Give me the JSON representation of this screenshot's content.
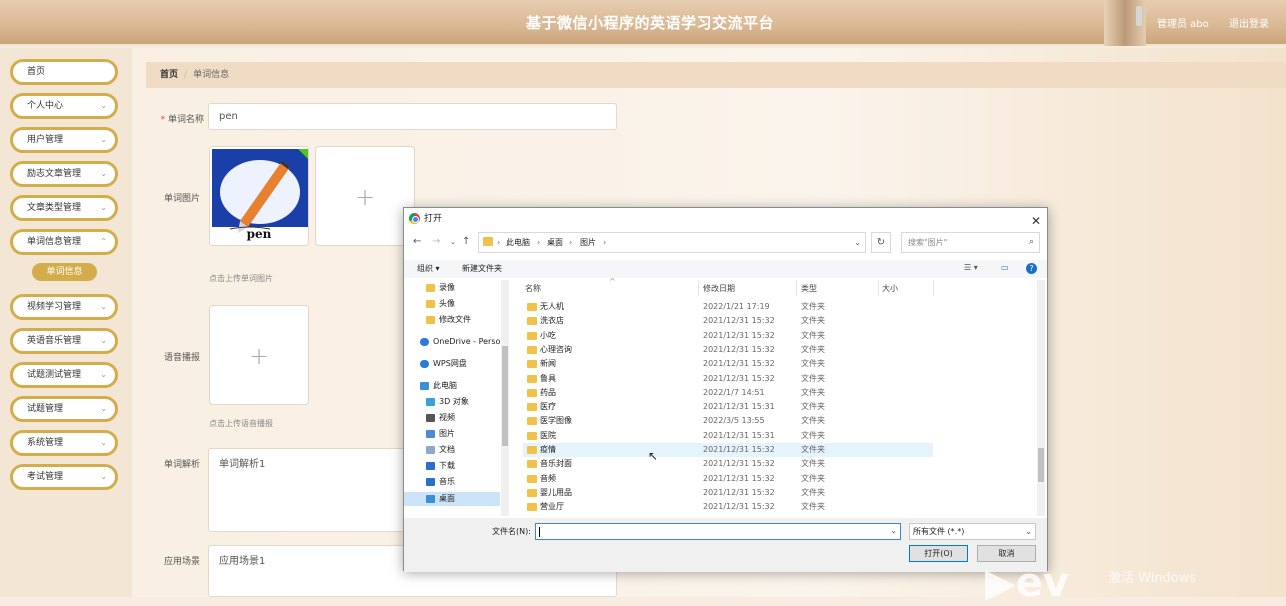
{
  "header": {
    "title": "基于微信小程序的英语学习交流平台",
    "user": "管理员 abo",
    "logout": "退出登录"
  },
  "sidebar": {
    "items": [
      {
        "label": "首页",
        "chev": false
      },
      {
        "label": "个人中心",
        "chev": true
      },
      {
        "label": "用户管理",
        "chev": true
      },
      {
        "label": "励志文章管理",
        "chev": true
      },
      {
        "label": "文章类型管理",
        "chev": true
      },
      {
        "label": "单词信息管理",
        "chev": true
      },
      {
        "label": "视频学习管理",
        "chev": true
      },
      {
        "label": "英语音乐管理",
        "chev": true
      },
      {
        "label": "试题测试管理",
        "chev": true
      },
      {
        "label": "试题管理",
        "chev": true
      },
      {
        "label": "系统管理",
        "chev": true
      },
      {
        "label": "考试管理",
        "chev": true
      }
    ],
    "sub_item": "单词信息"
  },
  "breadcrumb": {
    "home": "首页",
    "current": "单词信息"
  },
  "form": {
    "word_name_label": "单词名称",
    "word_name_value": "pen",
    "word_image_label": "单词图片",
    "image_caption": "pen",
    "image_hint": "点击上传单词图片",
    "audio_label": "语音播报",
    "audio_hint": "点击上传语音播报",
    "analysis_label": "单词解析",
    "analysis_value": "单词解析1",
    "scene_label": "应用场景",
    "scene_value": "应用场景1"
  },
  "dialog": {
    "title": "打开",
    "path": [
      "此电脑",
      "桌面",
      "图片"
    ],
    "search_placeholder": "搜索\"图片\"",
    "organize": "组织 ▾",
    "new_folder": "新建文件夹",
    "tree": [
      {
        "label": "录像",
        "icon": "folder-icon"
      },
      {
        "label": "头像",
        "icon": "folder-icon"
      },
      {
        "label": "修改文件",
        "icon": "folder-icon"
      },
      {
        "label": "OneDrive - Perso",
        "icon": "cloud-icon"
      },
      {
        "label": "WPS网盘",
        "icon": "cloud-icon"
      },
      {
        "label": "此电脑",
        "icon": "computer-icon"
      },
      {
        "label": "3D 对象",
        "icon": "cube-icon"
      },
      {
        "label": "视频",
        "icon": "video-icon"
      },
      {
        "label": "图片",
        "icon": "image-icon"
      },
      {
        "label": "文档",
        "icon": "document-icon"
      },
      {
        "label": "下载",
        "icon": "download-icon"
      },
      {
        "label": "音乐",
        "icon": "music-icon"
      },
      {
        "label": "桌面",
        "icon": "desktop-icon"
      }
    ],
    "columns": [
      "名称",
      "修改日期",
      "类型",
      "大小"
    ],
    "files": [
      {
        "name": "无人机",
        "date": "2022/1/21 17:19",
        "type": "文件夹"
      },
      {
        "name": "洗衣店",
        "date": "2021/12/31 15:32",
        "type": "文件夹"
      },
      {
        "name": "小吃",
        "date": "2021/12/31 15:32",
        "type": "文件夹"
      },
      {
        "name": "心理咨询",
        "date": "2021/12/31 15:32",
        "type": "文件夹"
      },
      {
        "name": "新闻",
        "date": "2021/12/31 15:32",
        "type": "文件夹"
      },
      {
        "name": "鲁具",
        "date": "2021/12/31 15:32",
        "type": "文件夹"
      },
      {
        "name": "药品",
        "date": "2022/1/7 14:51",
        "type": "文件夹"
      },
      {
        "name": "医疗",
        "date": "2021/12/31 15:31",
        "type": "文件夹"
      },
      {
        "name": "医学图像",
        "date": "2022/3/5 13:55",
        "type": "文件夹"
      },
      {
        "name": "医院",
        "date": "2021/12/31 15:31",
        "type": "文件夹"
      },
      {
        "name": "疫情",
        "date": "2021/12/31 15:32",
        "type": "文件夹"
      },
      {
        "name": "音乐封面",
        "date": "2021/12/31 15:32",
        "type": "文件夹"
      },
      {
        "name": "音频",
        "date": "2021/12/31 15:32",
        "type": "文件夹"
      },
      {
        "name": "婴儿用品",
        "date": "2021/12/31 15:32",
        "type": "文件夹"
      },
      {
        "name": "营业厅",
        "date": "2021/12/31 15:32",
        "type": "文件夹"
      }
    ],
    "filename_label": "文件名(N):",
    "filename_value": "",
    "filetype": "所有文件 (*.*)",
    "open_btn": "打开(O)",
    "cancel_btn": "取消"
  },
  "watermark": "激活 Windows",
  "colors": {
    "accent": "#d3ad4c",
    "header": "#d9b894"
  }
}
